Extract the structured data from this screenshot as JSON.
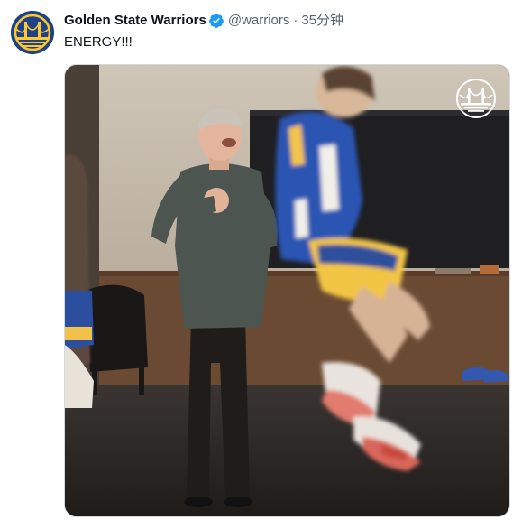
{
  "account": {
    "display_name": "Golden State Warriors",
    "handle": "@warriors",
    "separator": "·",
    "time_ago": "35分钟",
    "avatar_icon": "warriors-bridge-logo-icon",
    "verified_icon": "verified-badge-icon"
  },
  "tweet": {
    "text": "ENERGY!!!"
  },
  "media": {
    "type": "video-frame",
    "watermark_icon": "warriors-bridge-watermark-icon"
  },
  "colors": {
    "brand_blue": "#1d428a",
    "brand_gold": "#ffc72c",
    "verified_blue": "#1d9bf0",
    "text_primary": "#0f1419",
    "text_secondary": "#536471"
  }
}
